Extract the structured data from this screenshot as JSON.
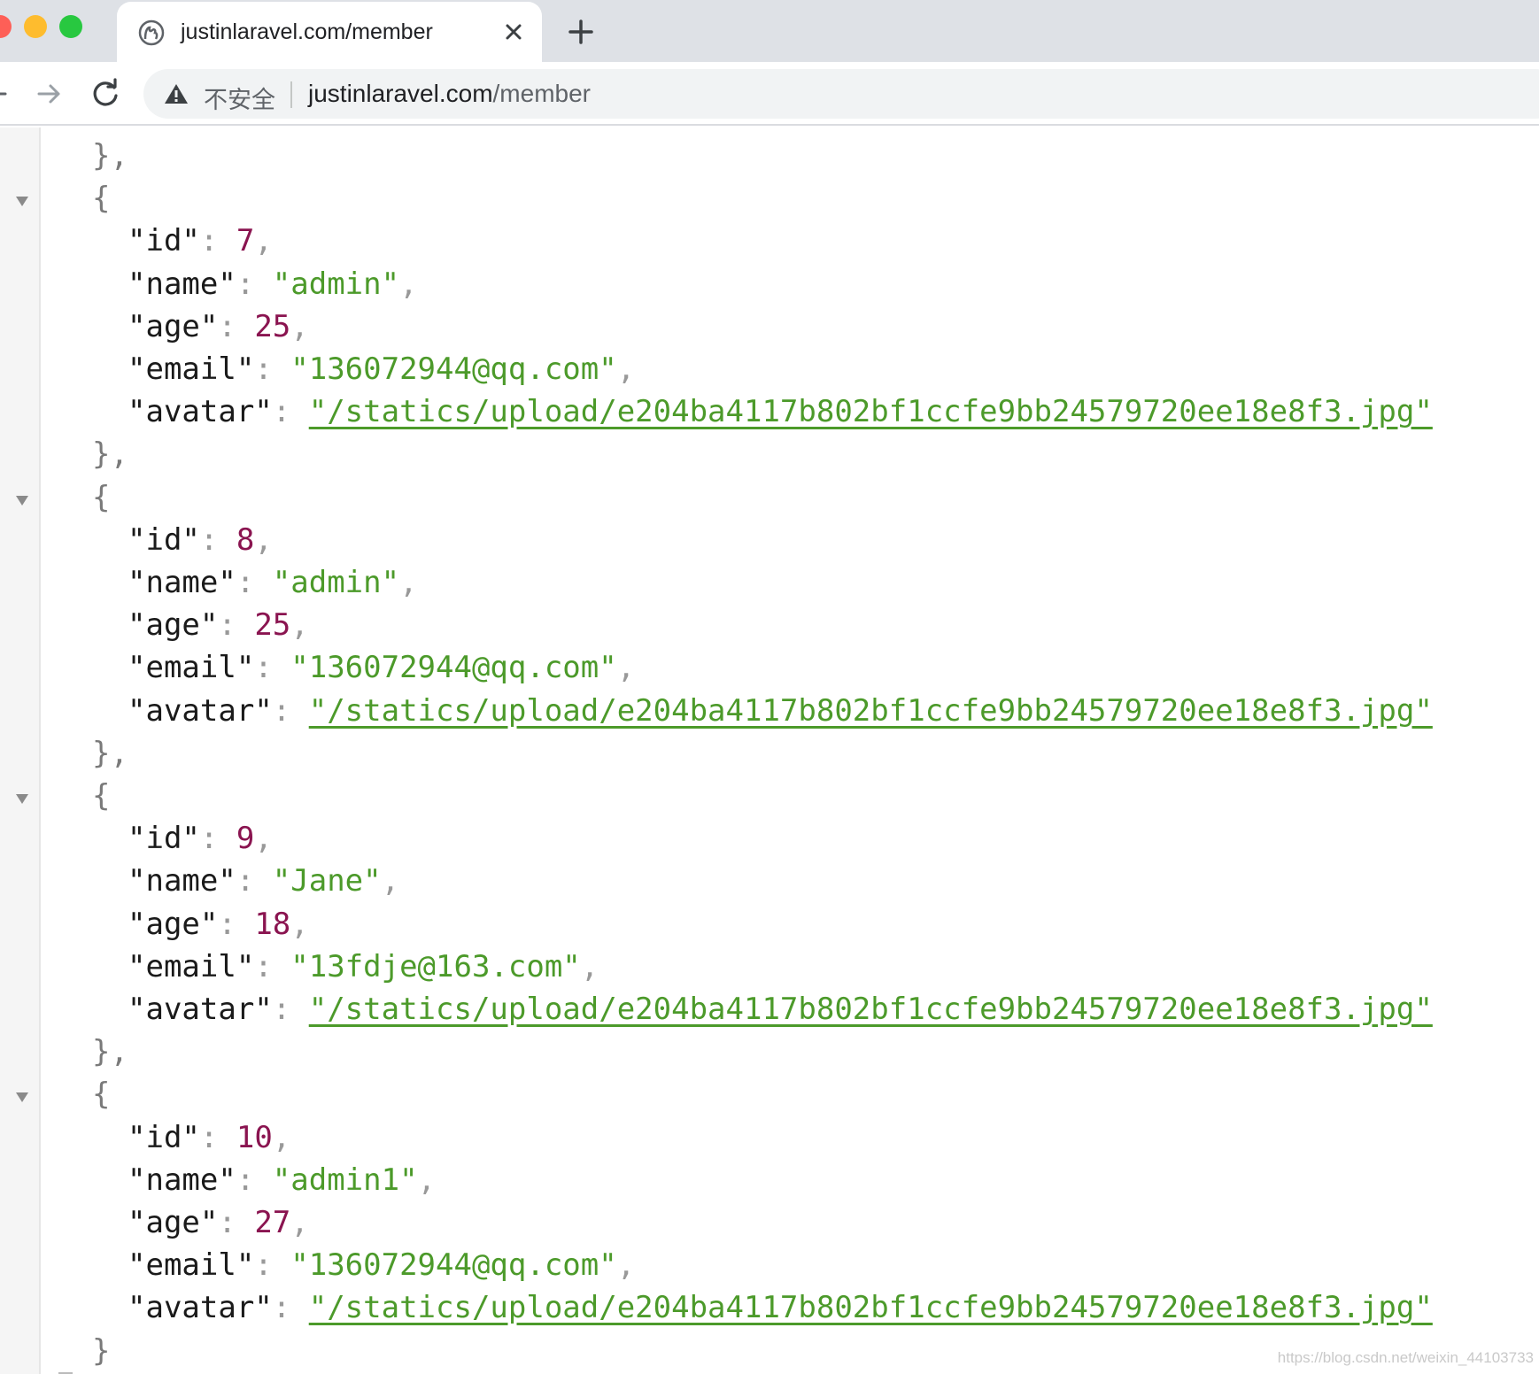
{
  "browser": {
    "tab": {
      "title": "justinlaravel.com/member",
      "favicon": "globe-icon"
    },
    "address_bar": {
      "security_label": "不安全",
      "url_host": "justinlaravel.com",
      "url_path": "/member"
    },
    "icons": {
      "back": "arrow-left-icon",
      "forward": "arrow-right-icon",
      "reload": "reload-icon",
      "close_tab": "close-icon",
      "new_tab": "plus-icon",
      "warning": "warning-icon"
    }
  },
  "json_view": {
    "leading_close": "},",
    "objects": [
      {
        "id": "7",
        "name": "\"admin\"",
        "age": "25",
        "email": "\"136072944@qq.com\"",
        "avatar": "\"/statics/upload/e204ba4117b802bf1ccfe9bb24579720ee18e8f3.jpg\"",
        "close": "},"
      },
      {
        "id": "8",
        "name": "\"admin\"",
        "age": "25",
        "email": "\"136072944@qq.com\"",
        "avatar": "\"/statics/upload/e204ba4117b802bf1ccfe9bb24579720ee18e8f3.jpg\"",
        "close": "},"
      },
      {
        "id": "9",
        "name": "\"Jane\"",
        "age": "18",
        "email": "\"13fdje@163.com\"",
        "avatar": "\"/statics/upload/e204ba4117b802bf1ccfe9bb24579720ee18e8f3.jpg\"",
        "close": "},"
      },
      {
        "id": "10",
        "name": "\"admin1\"",
        "age": "27",
        "email": "\"136072944@qq.com\"",
        "avatar": "\"/statics/upload/e204ba4117b802bf1ccfe9bb24579720ee18e8f3.jpg\"",
        "close": "}"
      }
    ],
    "keys": {
      "id": "\"id\"",
      "name": "\"name\"",
      "age": "\"age\"",
      "email": "\"email\"",
      "avatar": "\"avatar\""
    },
    "open_brace": "{",
    "colon": ": ",
    "comma": ","
  },
  "watermark": "https://blog.csdn.net/weixin_44103733",
  "colors": {
    "number": "#8a1450",
    "string": "#4c9a2a",
    "key": "#1a1a1a",
    "punctuation": "#999999"
  }
}
